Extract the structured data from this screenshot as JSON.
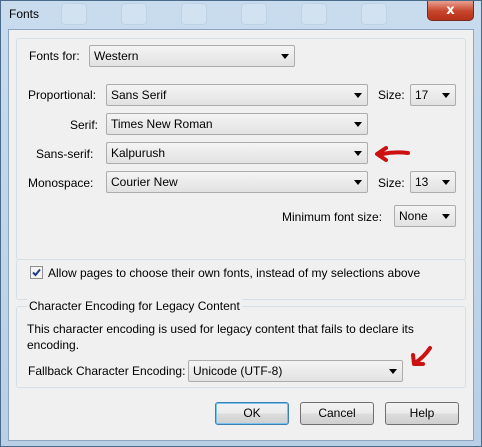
{
  "window": {
    "title": "Fonts",
    "close_glyph": "x"
  },
  "fonts_for": {
    "label": "Fonts for:",
    "value": "Western"
  },
  "proportional": {
    "label": "Proportional:",
    "value": "Sans Serif",
    "size_label": "Size:",
    "size": "17"
  },
  "serif": {
    "label": "Serif:",
    "value": "Times New Roman"
  },
  "sans_serif": {
    "label": "Sans-serif:",
    "value": "Kalpurush"
  },
  "monospace": {
    "label": "Monospace:",
    "value": "Courier New",
    "size_label": "Size:",
    "size": "13"
  },
  "minimum_font_size": {
    "label": "Minimum font size:",
    "value": "None"
  },
  "allow_pages": {
    "label": "Allow pages to choose their own fonts, instead of my selections above",
    "checked": true
  },
  "encoding": {
    "group_title": "Character Encoding for Legacy Content",
    "description": "This character encoding is used for legacy content that fails to declare its encoding.",
    "fallback_label": "Fallback Character Encoding:",
    "fallback_value": "Unicode (UTF-8)"
  },
  "buttons": {
    "ok": "OK",
    "cancel": "Cancel",
    "help": "Help"
  },
  "annotation_color": "#cc1111",
  "icons": [
    "close-icon",
    "dropdown-arrow-icon",
    "checkmark-icon",
    "red-arrow-icon"
  ]
}
